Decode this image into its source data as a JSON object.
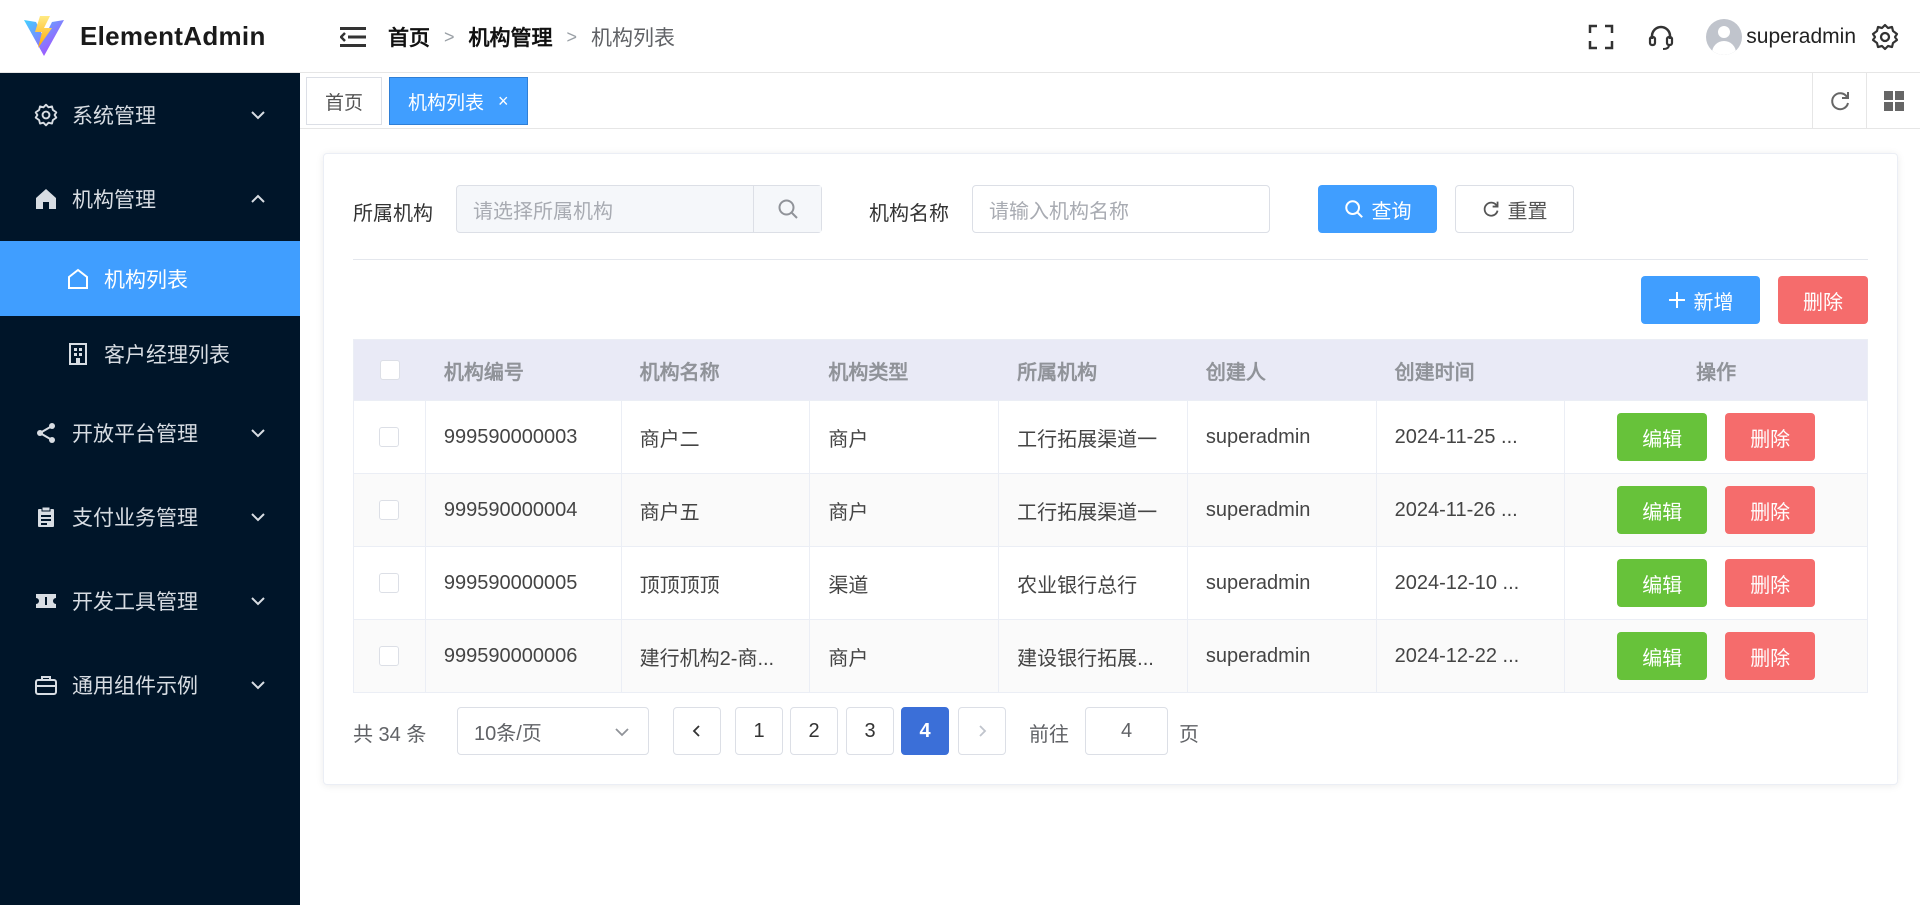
{
  "app": {
    "name": "ElementAdmin"
  },
  "header": {
    "breadcrumb": [
      "首页",
      "机构管理",
      "机构列表"
    ],
    "user_name": "superadmin"
  },
  "sidebar": {
    "menus": [
      {
        "label": "系统管理",
        "icon": "gear-icon",
        "expanded": false
      },
      {
        "label": "机构管理",
        "icon": "home-icon",
        "expanded": true
      },
      {
        "label": "开放平台管理",
        "icon": "share-icon",
        "expanded": false
      },
      {
        "label": "支付业务管理",
        "icon": "clipboard-icon",
        "expanded": false
      },
      {
        "label": "开发工具管理",
        "icon": "ticket-icon",
        "expanded": false
      },
      {
        "label": "通用组件示例",
        "icon": "briefcase-icon",
        "expanded": false
      }
    ],
    "sub_items": [
      {
        "label": "机构列表",
        "icon": "house-outline-icon",
        "active": true
      },
      {
        "label": "客户经理列表",
        "icon": "building-icon",
        "active": false
      }
    ]
  },
  "tabs": [
    {
      "label": "首页",
      "active": false
    },
    {
      "label": "机构列表",
      "active": true,
      "close": "×"
    }
  ],
  "search": {
    "org_label": "所属机构",
    "org_placeholder": "请选择所属机构",
    "name_label": "机构名称",
    "name_placeholder": "请输入机构名称",
    "query_label": "查询",
    "reset_label": "重置"
  },
  "toolbar": {
    "add_label": "新增",
    "delete_label": "删除"
  },
  "table": {
    "columns": [
      "机构编号",
      "机构名称",
      "机构类型",
      "所属机构",
      "创建人",
      "创建时间",
      "操作"
    ],
    "rows": [
      {
        "code": "999590000003",
        "name": "商户二",
        "type": "商户",
        "parent": "工行拓展渠道一",
        "creator": "superadmin",
        "created": "2024-11-25 ...",
        "edit": "编辑",
        "delete": "删除"
      },
      {
        "code": "999590000004",
        "name": "商户五",
        "type": "商户",
        "parent": "工行拓展渠道一",
        "creator": "superadmin",
        "created": "2024-11-26 ...",
        "edit": "编辑",
        "delete": "删除"
      },
      {
        "code": "999590000005",
        "name": "顶顶顶顶",
        "type": "渠道",
        "parent": "农业银行总行",
        "creator": "superadmin",
        "created": "2024-12-10 ...",
        "edit": "编辑",
        "delete": "删除"
      },
      {
        "code": "999590000006",
        "name": "建行机构2-商...",
        "type": "商户",
        "parent": "建设银行拓展...",
        "creator": "superadmin",
        "created": "2024-12-22 ...",
        "edit": "编辑",
        "delete": "删除"
      }
    ]
  },
  "pagination": {
    "total_text": "共 34 条",
    "page_size": "10条/页",
    "pages": [
      "1",
      "2",
      "3",
      "4"
    ],
    "current": "4",
    "goto_label": "前往",
    "goto_value": "4",
    "page_suffix": "页"
  },
  "colors": {
    "primary": "#409eff",
    "danger": "#f56c6c",
    "success": "#67c23a",
    "sidebar_bg": "#001529"
  }
}
